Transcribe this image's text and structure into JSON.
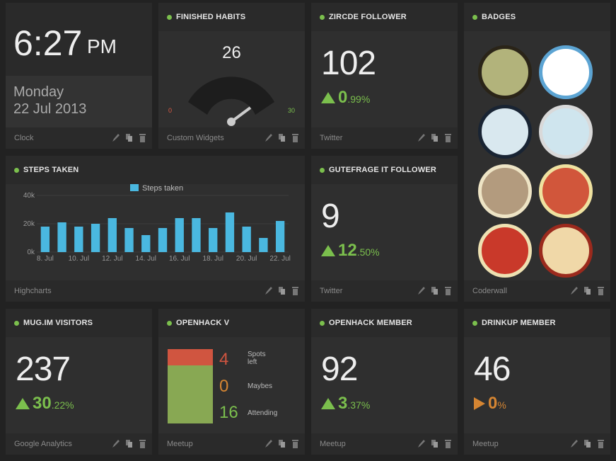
{
  "clock": {
    "time": "6:27",
    "ampm": "PM",
    "day": "Monday",
    "date": "22 Jul 2013",
    "footer": "Clock"
  },
  "habits": {
    "title": "FINISHED HABITS",
    "value": "26",
    "min": "0",
    "max": "30",
    "footer": "Custom Widgets"
  },
  "zircde": {
    "title": "ZIRCDE FOLLOWER",
    "value": "102",
    "change_int": "0",
    "change_dec": ".99%",
    "footer": "Twitter"
  },
  "badges": {
    "title": "BADGES",
    "footer": "Coderwall",
    "items": [
      "mammoth-badge",
      "raccoon-badge",
      "raven-badge",
      "penguin-nest-badge",
      "spider-badge",
      "walrus-badge",
      "marmot-3-badge",
      "marmot-badge"
    ]
  },
  "steps": {
    "title": "STEPS TAKEN",
    "legend": "Steps taken",
    "footer": "Highcharts"
  },
  "gutefrage": {
    "title": "GUTEFRAGE IT FOLLOWER",
    "value": "9",
    "change_int": "12",
    "change_dec": ".50%",
    "footer": "Twitter"
  },
  "mugim": {
    "title": "MUG.IM VISITORS",
    "value": "237",
    "change_int": "30",
    "change_dec": ".22%",
    "footer": "Google Analytics"
  },
  "openhack": {
    "title": "OPENHACK V",
    "spots": "4",
    "spots_label": "Spots left",
    "maybes": "0",
    "maybes_label": "Maybes",
    "attending": "16",
    "attending_label": "Attending",
    "footer": "Meetup"
  },
  "ohmember": {
    "title": "OPENHACK MEMBER",
    "value": "92",
    "change_int": "3",
    "change_dec": ".37%",
    "footer": "Meetup"
  },
  "drinkup": {
    "title": "DRINKUP MEMBER",
    "value": "46",
    "change_int": "0",
    "change_dec": "%",
    "footer": "Meetup"
  },
  "chart_data": {
    "type": "bar",
    "series": [
      {
        "name": "Steps taken",
        "values": [
          18000,
          21000,
          18000,
          20000,
          24000,
          17000,
          12000,
          17000,
          24000,
          24000,
          17000,
          28000,
          18000,
          10000,
          22000
        ]
      }
    ],
    "categories": [
      "8. Jul",
      "9. Jul",
      "10. Jul",
      "11. Jul",
      "12. Jul",
      "13. Jul",
      "14. Jul",
      "15. Jul",
      "16. Jul",
      "17. Jul",
      "18. Jul",
      "19. Jul",
      "20. Jul",
      "21. Jul",
      "22. Jul"
    ],
    "x_tick_labels": [
      "8. Jul",
      "10. Jul",
      "12. Jul",
      "14. Jul",
      "16. Jul",
      "18. Jul",
      "20. Jul",
      "22. Jul"
    ],
    "y_tick_labels": [
      "0k",
      "20k",
      "40k"
    ],
    "ylim": [
      0,
      40000
    ],
    "color": "#4ab8e0",
    "legend": "top-center",
    "grid": true
  }
}
